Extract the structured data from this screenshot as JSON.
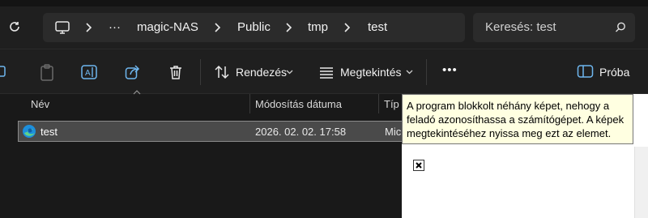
{
  "address_bar": {
    "crumbs": [
      "magic-NAS",
      "Public",
      "tmp",
      "test"
    ],
    "overflow": "···"
  },
  "search": {
    "placeholder": "Keresés: test"
  },
  "toolbar": {
    "sort_label": "Rendezés",
    "view_label": "Megtekintés",
    "more_label": "•••",
    "preview_label": "Próba"
  },
  "columns": {
    "name": "Név",
    "modified": "Módosítás dátuma",
    "type": "Típ"
  },
  "rows": [
    {
      "name": "test",
      "modified": "2026. 02. 02. 17:58",
      "type": "Mic"
    }
  ],
  "preview": {
    "tooltip": "A program blokkolt néhány képet, nehogy a feladó azonosíthassa a számítógépet. A képek megtekintéséhez nyissa meg ezt az elemet."
  },
  "icons": [
    "refresh-icon",
    "computer-icon",
    "chevron-right-icon",
    "search-icon",
    "copy-icon",
    "paste-icon",
    "rename-icon",
    "share-icon",
    "delete-icon",
    "sort-icon",
    "view-icon",
    "preview-pane-icon",
    "edge-icon",
    "broken-image-icon"
  ]
}
